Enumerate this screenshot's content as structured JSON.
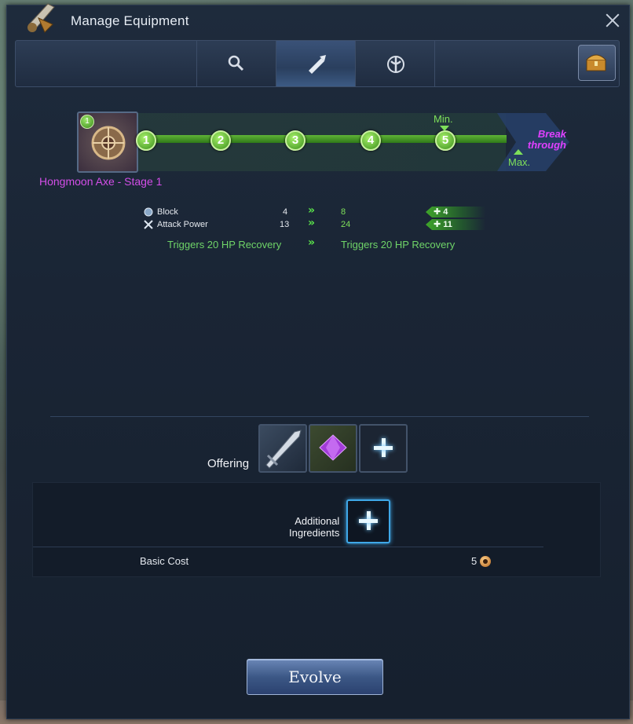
{
  "window": {
    "title": "Manage Equipment"
  },
  "tabs": [
    {
      "icon": "search-icon"
    },
    {
      "icon": "evolve-tab-icon",
      "active": true
    },
    {
      "icon": "transform-tab-icon"
    }
  ],
  "item": {
    "level_badge": "1",
    "name": "Hongmoon Axe - Stage 1"
  },
  "progress": {
    "stages": [
      "1",
      "2",
      "3",
      "4",
      "5"
    ],
    "min_label": "Min.",
    "max_label": "Max.",
    "breakthrough_line1": "Break",
    "breakthrough_line2": "through"
  },
  "stats": [
    {
      "icon": "block-icon",
      "label": "Block",
      "current": "4",
      "new": "8",
      "delta": "4"
    },
    {
      "icon": "attack-power-icon",
      "label": "Attack Power",
      "current": "13",
      "new": "24",
      "delta": "11"
    }
  ],
  "trigger": {
    "current": "Triggers 20 HP Recovery",
    "new": "Triggers 20 HP Recovery"
  },
  "offering": {
    "label": "Offering"
  },
  "additional": {
    "label_line1": "Additional",
    "label_line2": "Ingredients"
  },
  "cost": {
    "label": "Basic Cost",
    "value": "5"
  },
  "buttons": {
    "evolve": "Evolve"
  },
  "colors": {
    "accent_green": "#7ee05a",
    "item_name": "#d34ee8",
    "breakthrough": "#e040ff"
  }
}
